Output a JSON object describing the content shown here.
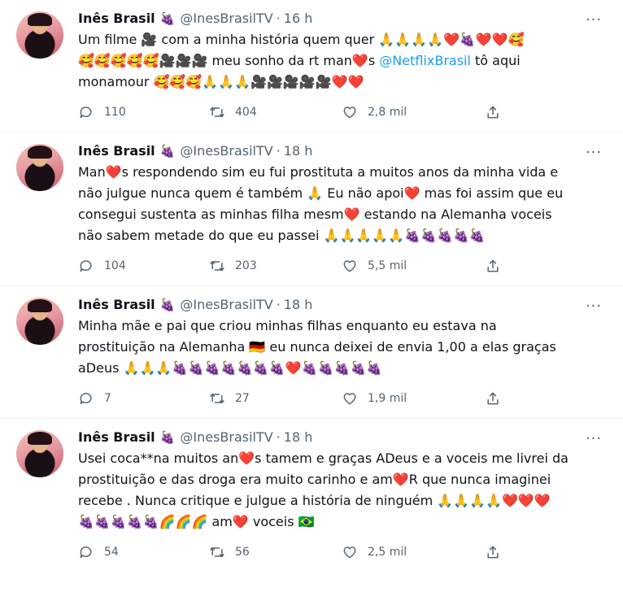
{
  "icons": {
    "reply": "reply-icon",
    "retweet": "retweet-icon",
    "like": "heart-icon",
    "share": "share-icon",
    "more": "more-icon"
  },
  "tweets": [
    {
      "name": "Inês Brasil",
      "badge": "🍇",
      "handle": "@InesBrasilTV",
      "sep": "·",
      "time": "16 h",
      "more": "···",
      "text_a": "Um filme 🎥 com a minha história quem quer 🙏🙏🙏🙏❤️🍇❤️❤️🥰\n🥰🥰🥰🥰🥰🎥🎥🎥 meu sonho da rt man❤️s ",
      "mention": "@NetflixBrasil",
      "text_b": " tô aqui\nmonamour 🥰🥰🥰🙏🙏🙏🎥🎥🎥🎥🎥❤️❤️",
      "replies": "110",
      "retweets": "404",
      "likes": "2,8 mil"
    },
    {
      "name": "Inês Brasil",
      "badge": "🍇",
      "handle": "@InesBrasilTV",
      "sep": "·",
      "time": "18 h",
      "more": "···",
      "text": "Man❤️s respondendo sim eu fui prostituta a muitos anos da minha vida e\nnão julgue nunca quem é também 🙏 Eu não apoi❤️ mas foi assim que eu\nconsegui sustenta as minhas filha mesm❤️ estando na Alemanha voceis\nnão sabem metade do que eu passei 🙏🙏🙏🙏🙏🍇🍇🍇🍇🍇",
      "replies": "104",
      "retweets": "203",
      "likes": "5,5 mil"
    },
    {
      "name": "Inês Brasil",
      "badge": "🍇",
      "handle": "@InesBrasilTV",
      "sep": "·",
      "time": "18 h",
      "more": "···",
      "text": "Minha mãe e pai que criou minhas filhas enquanto eu estava na\nprostituição na Alemanha 🇩🇪 eu nunca deixei de envia 1,00 a elas graças\naDeus 🙏🙏🙏🍇🍇🍇🍇🍇🍇🍇❤️🍇🍇🍇🍇🍇",
      "replies": "7",
      "retweets": "27",
      "likes": "1,9 mil"
    },
    {
      "name": "Inês Brasil",
      "badge": "🍇",
      "handle": "@InesBrasilTV",
      "sep": "·",
      "time": "18 h",
      "more": "···",
      "text": "Usei coca**na muitos an❤️s tamem e graças ADeus e a voceis me livrei da\nprostituição e das droga era muito carinho e am❤️R que nunca imaginei\nrecebe . Nunca critique e julgue a história de ninguém 🙏🙏🙏🙏❤️❤️❤️\n🍇🍇🍇🍇🍇🌈🌈🌈 am❤️ voceis 🇧🇷",
      "replies": "54",
      "retweets": "56",
      "likes": "2,5 mil"
    }
  ]
}
